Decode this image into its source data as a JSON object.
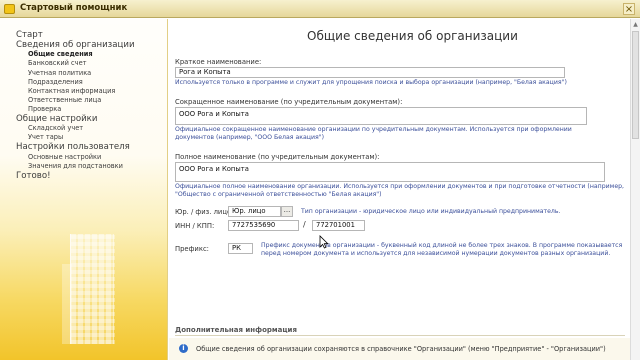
{
  "window": {
    "title": "Стартовый помощник",
    "close_label": "×"
  },
  "nav": {
    "items": [
      {
        "label": "Старт",
        "level": 1,
        "active": false
      },
      {
        "label": "Сведения об организации",
        "level": 1,
        "active": false
      },
      {
        "label": "Общие сведения",
        "level": 2,
        "active": true
      },
      {
        "label": "Банковский счет",
        "level": 2,
        "active": false
      },
      {
        "label": "Учетная политика",
        "level": 2,
        "active": false
      },
      {
        "label": "Подразделения",
        "level": 2,
        "active": false
      },
      {
        "label": "Контактная информация",
        "level": 2,
        "active": false
      },
      {
        "label": "Ответственные лица",
        "level": 2,
        "active": false
      },
      {
        "label": "Проверка",
        "level": 2,
        "active": false
      },
      {
        "label": "Общие настройки",
        "level": 1,
        "active": false
      },
      {
        "label": "Складской учет",
        "level": 2,
        "active": false
      },
      {
        "label": "Учет тары",
        "level": 2,
        "active": false
      },
      {
        "label": "Настройки пользователя",
        "level": 1,
        "active": false
      },
      {
        "label": "Основные настройки",
        "level": 2,
        "active": false
      },
      {
        "label": "Значения для подстановки",
        "level": 2,
        "active": false
      },
      {
        "label": "Готово!",
        "level": 1,
        "active": false
      }
    ]
  },
  "main": {
    "title": "Общие сведения об организации",
    "short_name": {
      "label": "Краткое наименование:",
      "value": "Рога и Копыта",
      "hint": "Используется только в программе и служит для упрощения поиска и выбора организации (например, \"Белая акация\")"
    },
    "abbrev_name": {
      "label": "Сокращенное наименование (по учредительным документам):",
      "value": "ООО Рога и Копыта",
      "hint_lines": [
        "Официальное сокращенное наименование организации по учредительным документам. Используется при оформлении",
        "документов (например, \"ООО Белая акация\")"
      ]
    },
    "full_name": {
      "label": "Полное наименование (по учредительным документам):",
      "value": "ООО Рога и Копыта",
      "hint_lines": [
        "Официальное полное наименование организации. Используется при оформлении документов и при подготовке отчетности (например,",
        "\"Общество с ограниченной ответственностью \"Белая акация\")"
      ]
    },
    "entity_type": {
      "label": "Юр. / физ. лицо:",
      "value": "Юр. лицо",
      "button": "...",
      "hint": "Тип организации - юридическое лицо или индивидуальный предприниматель."
    },
    "inn_kpp": {
      "label": "ИНН / КПП:",
      "inn": "7727535690",
      "separator": "/",
      "kpp": "772701001"
    },
    "prefix": {
      "label": "Префикс:",
      "value": "РК",
      "hint_lines": [
        "Префикс документов организации - буквенный код длиной не более трех знаков. В программе показывается",
        "перед номером документа и используется для независимой нумерации документов разных организаций."
      ]
    },
    "additional": {
      "title": "Дополнительная информация",
      "info_icon": "i",
      "text": "Общие сведения об организации сохраняются в справочнике \"Организации\" (меню \"Предприятие\" - \"Организации\")"
    }
  },
  "colors": {
    "title_bar": "#e6d79a",
    "nav_gradient_end": "#f2c42a",
    "hint_text": "#3b4f9a",
    "info_icon": "#2f6cc9"
  },
  "icons": {
    "window_icon": "app-icon",
    "close": "close-icon",
    "info": "info-icon",
    "cursor": "mouse-pointer-icon"
  }
}
